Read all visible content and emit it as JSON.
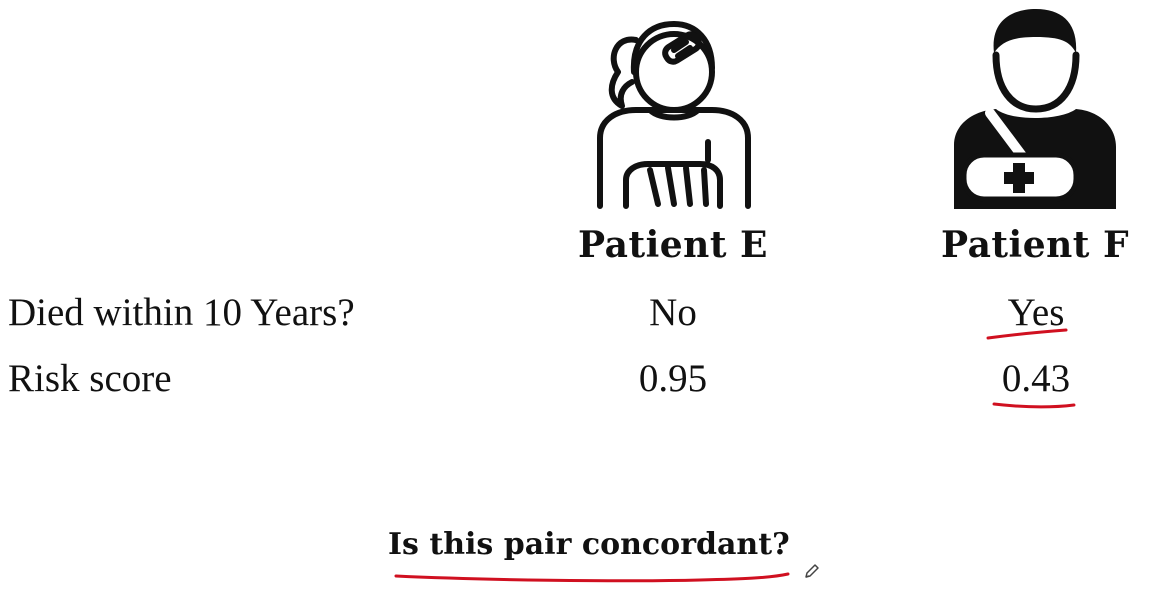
{
  "patients": [
    {
      "name": "Patient E",
      "died": "No",
      "risk": "0.95"
    },
    {
      "name": "Patient F",
      "died": "Yes",
      "risk": "0.43"
    }
  ],
  "rows": {
    "died_label": "Died within 10 Years?",
    "risk_label": "Risk score"
  },
  "question": "Is this pair concordant?",
  "colors": {
    "ink": "#111111",
    "annotation": "#d01020"
  },
  "icons": {
    "patient_e": "injured-woman-arm-cast-icon",
    "patient_f": "injured-man-arm-sling-icon",
    "cursor": "pen-cursor-icon"
  }
}
